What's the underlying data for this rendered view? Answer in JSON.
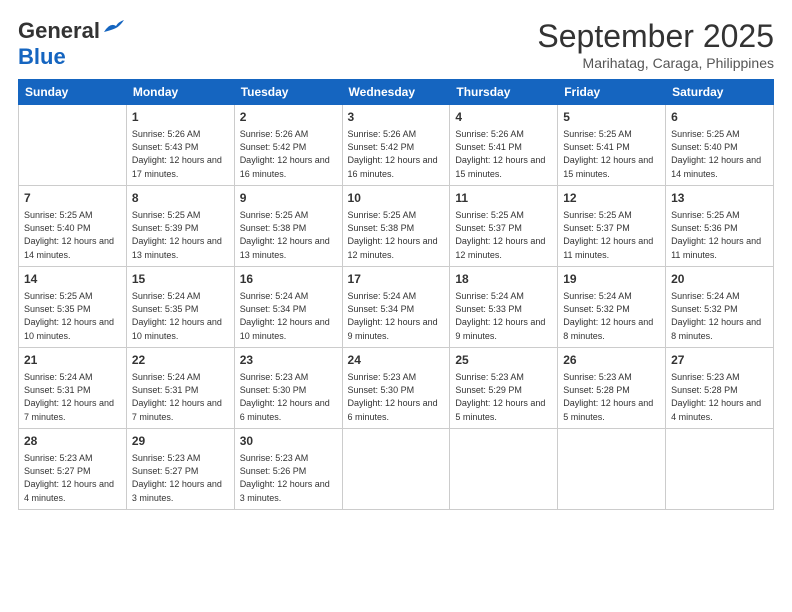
{
  "header": {
    "logo_general": "General",
    "logo_blue": "Blue",
    "month": "September 2025",
    "location": "Marihatag, Caraga, Philippines"
  },
  "weekdays": [
    "Sunday",
    "Monday",
    "Tuesday",
    "Wednesday",
    "Thursday",
    "Friday",
    "Saturday"
  ],
  "weeks": [
    [
      {
        "day": "",
        "sunrise": "",
        "sunset": "",
        "daylight": ""
      },
      {
        "day": "1",
        "sunrise": "Sunrise: 5:26 AM",
        "sunset": "Sunset: 5:43 PM",
        "daylight": "Daylight: 12 hours and 17 minutes."
      },
      {
        "day": "2",
        "sunrise": "Sunrise: 5:26 AM",
        "sunset": "Sunset: 5:42 PM",
        "daylight": "Daylight: 12 hours and 16 minutes."
      },
      {
        "day": "3",
        "sunrise": "Sunrise: 5:26 AM",
        "sunset": "Sunset: 5:42 PM",
        "daylight": "Daylight: 12 hours and 16 minutes."
      },
      {
        "day": "4",
        "sunrise": "Sunrise: 5:26 AM",
        "sunset": "Sunset: 5:41 PM",
        "daylight": "Daylight: 12 hours and 15 minutes."
      },
      {
        "day": "5",
        "sunrise": "Sunrise: 5:25 AM",
        "sunset": "Sunset: 5:41 PM",
        "daylight": "Daylight: 12 hours and 15 minutes."
      },
      {
        "day": "6",
        "sunrise": "Sunrise: 5:25 AM",
        "sunset": "Sunset: 5:40 PM",
        "daylight": "Daylight: 12 hours and 14 minutes."
      }
    ],
    [
      {
        "day": "7",
        "sunrise": "Sunrise: 5:25 AM",
        "sunset": "Sunset: 5:40 PM",
        "daylight": "Daylight: 12 hours and 14 minutes."
      },
      {
        "day": "8",
        "sunrise": "Sunrise: 5:25 AM",
        "sunset": "Sunset: 5:39 PM",
        "daylight": "Daylight: 12 hours and 13 minutes."
      },
      {
        "day": "9",
        "sunrise": "Sunrise: 5:25 AM",
        "sunset": "Sunset: 5:38 PM",
        "daylight": "Daylight: 12 hours and 13 minutes."
      },
      {
        "day": "10",
        "sunrise": "Sunrise: 5:25 AM",
        "sunset": "Sunset: 5:38 PM",
        "daylight": "Daylight: 12 hours and 12 minutes."
      },
      {
        "day": "11",
        "sunrise": "Sunrise: 5:25 AM",
        "sunset": "Sunset: 5:37 PM",
        "daylight": "Daylight: 12 hours and 12 minutes."
      },
      {
        "day": "12",
        "sunrise": "Sunrise: 5:25 AM",
        "sunset": "Sunset: 5:37 PM",
        "daylight": "Daylight: 12 hours and 11 minutes."
      },
      {
        "day": "13",
        "sunrise": "Sunrise: 5:25 AM",
        "sunset": "Sunset: 5:36 PM",
        "daylight": "Daylight: 12 hours and 11 minutes."
      }
    ],
    [
      {
        "day": "14",
        "sunrise": "Sunrise: 5:25 AM",
        "sunset": "Sunset: 5:35 PM",
        "daylight": "Daylight: 12 hours and 10 minutes."
      },
      {
        "day": "15",
        "sunrise": "Sunrise: 5:24 AM",
        "sunset": "Sunset: 5:35 PM",
        "daylight": "Daylight: 12 hours and 10 minutes."
      },
      {
        "day": "16",
        "sunrise": "Sunrise: 5:24 AM",
        "sunset": "Sunset: 5:34 PM",
        "daylight": "Daylight: 12 hours and 10 minutes."
      },
      {
        "day": "17",
        "sunrise": "Sunrise: 5:24 AM",
        "sunset": "Sunset: 5:34 PM",
        "daylight": "Daylight: 12 hours and 9 minutes."
      },
      {
        "day": "18",
        "sunrise": "Sunrise: 5:24 AM",
        "sunset": "Sunset: 5:33 PM",
        "daylight": "Daylight: 12 hours and 9 minutes."
      },
      {
        "day": "19",
        "sunrise": "Sunrise: 5:24 AM",
        "sunset": "Sunset: 5:32 PM",
        "daylight": "Daylight: 12 hours and 8 minutes."
      },
      {
        "day": "20",
        "sunrise": "Sunrise: 5:24 AM",
        "sunset": "Sunset: 5:32 PM",
        "daylight": "Daylight: 12 hours and 8 minutes."
      }
    ],
    [
      {
        "day": "21",
        "sunrise": "Sunrise: 5:24 AM",
        "sunset": "Sunset: 5:31 PM",
        "daylight": "Daylight: 12 hours and 7 minutes."
      },
      {
        "day": "22",
        "sunrise": "Sunrise: 5:24 AM",
        "sunset": "Sunset: 5:31 PM",
        "daylight": "Daylight: 12 hours and 7 minutes."
      },
      {
        "day": "23",
        "sunrise": "Sunrise: 5:23 AM",
        "sunset": "Sunset: 5:30 PM",
        "daylight": "Daylight: 12 hours and 6 minutes."
      },
      {
        "day": "24",
        "sunrise": "Sunrise: 5:23 AM",
        "sunset": "Sunset: 5:30 PM",
        "daylight": "Daylight: 12 hours and 6 minutes."
      },
      {
        "day": "25",
        "sunrise": "Sunrise: 5:23 AM",
        "sunset": "Sunset: 5:29 PM",
        "daylight": "Daylight: 12 hours and 5 minutes."
      },
      {
        "day": "26",
        "sunrise": "Sunrise: 5:23 AM",
        "sunset": "Sunset: 5:28 PM",
        "daylight": "Daylight: 12 hours and 5 minutes."
      },
      {
        "day": "27",
        "sunrise": "Sunrise: 5:23 AM",
        "sunset": "Sunset: 5:28 PM",
        "daylight": "Daylight: 12 hours and 4 minutes."
      }
    ],
    [
      {
        "day": "28",
        "sunrise": "Sunrise: 5:23 AM",
        "sunset": "Sunset: 5:27 PM",
        "daylight": "Daylight: 12 hours and 4 minutes."
      },
      {
        "day": "29",
        "sunrise": "Sunrise: 5:23 AM",
        "sunset": "Sunset: 5:27 PM",
        "daylight": "Daylight: 12 hours and 3 minutes."
      },
      {
        "day": "30",
        "sunrise": "Sunrise: 5:23 AM",
        "sunset": "Sunset: 5:26 PM",
        "daylight": "Daylight: 12 hours and 3 minutes."
      },
      {
        "day": "",
        "sunrise": "",
        "sunset": "",
        "daylight": ""
      },
      {
        "day": "",
        "sunrise": "",
        "sunset": "",
        "daylight": ""
      },
      {
        "day": "",
        "sunrise": "",
        "sunset": "",
        "daylight": ""
      },
      {
        "day": "",
        "sunrise": "",
        "sunset": "",
        "daylight": ""
      }
    ]
  ]
}
